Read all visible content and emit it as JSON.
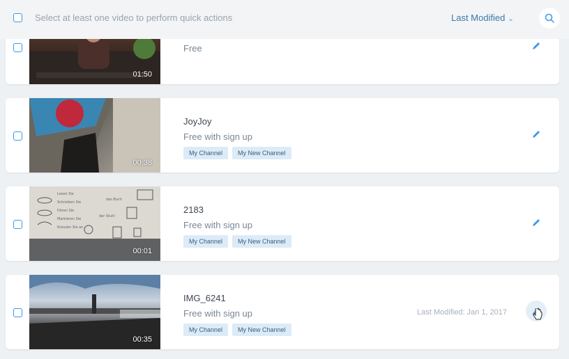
{
  "toolbar": {
    "select_hint": "Select at least one video to perform quick actions",
    "sort_label": "Last Modified"
  },
  "videos": [
    {
      "title": "",
      "pricing": "Free",
      "duration": "01:50",
      "tags": []
    },
    {
      "title": "JoyJoy",
      "pricing": "Free with sign up",
      "duration": "00:38",
      "tags": [
        "My Channel",
        "My New Channel"
      ]
    },
    {
      "title": "2183",
      "pricing": "Free with sign up",
      "duration": "00:01",
      "tags": [
        "My Channel",
        "My New Channel"
      ]
    },
    {
      "title": "IMG_6241",
      "pricing": "Free with sign up",
      "duration": "00:35",
      "tags": [
        "My Channel",
        "My New Channel"
      ],
      "last_modified": "Last Modified: Jan 1, 2017"
    }
  ],
  "colors": {
    "accent": "#3899ec",
    "background": "#eef1f4"
  }
}
